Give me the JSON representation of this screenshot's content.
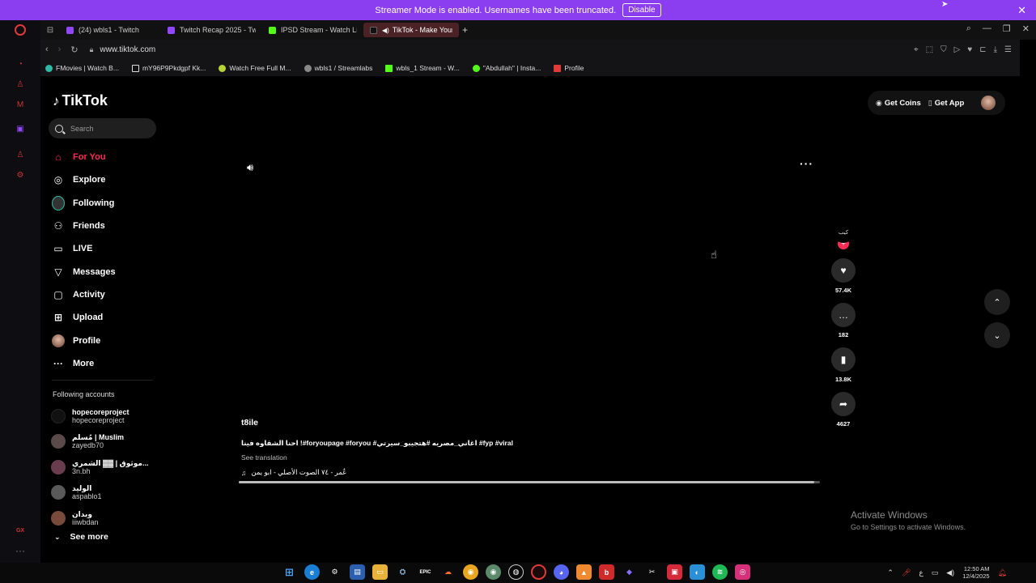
{
  "banner": {
    "message": "Streamer Mode is enabled. Usernames have been truncated.",
    "disable_label": "Disable"
  },
  "tabs": [
    {
      "label": "(24) wbls1 - Twitch",
      "color": "#9146ff"
    },
    {
      "label": "Twitch Recap 2025 - Twit",
      "color": "#9146ff"
    },
    {
      "label": "IPSD Stream - Watch Live",
      "color": "#53fc18"
    },
    {
      "label": "TikTok - Make Your D",
      "color": "#111111"
    }
  ],
  "address": {
    "url": "www.tiktok.com"
  },
  "bookmarks": [
    {
      "label": "FMovies | Watch B...",
      "color": "#2fb9a6"
    },
    {
      "label": "mY96P9Pkdgpf Kk...",
      "color": "#dddddd"
    },
    {
      "label": "Watch Free Full M...",
      "color": "#b5d334"
    },
    {
      "label": "wbls1 / Streamlabs",
      "color": "#888888"
    },
    {
      "label": "wbls_1 Stream - W...",
      "color": "#53fc18"
    },
    {
      "label": "\"Abdullah\" | Insta...",
      "color": "#53fc18"
    },
    {
      "label": "Profile",
      "color": "#e03a3a"
    }
  ],
  "tiktok": {
    "logo": "TikTok",
    "search_placeholder": "Search",
    "menu": [
      {
        "label": "For You",
        "icon": "home-icon"
      },
      {
        "label": "Explore",
        "icon": "compass-icon"
      },
      {
        "label": "Following",
        "icon": "following-icon"
      },
      {
        "label": "Friends",
        "icon": "friends-icon"
      },
      {
        "label": "LIVE",
        "icon": "live-icon"
      },
      {
        "label": "Messages",
        "icon": "messages-icon"
      },
      {
        "label": "Activity",
        "icon": "activity-icon"
      },
      {
        "label": "Upload",
        "icon": "upload-icon"
      },
      {
        "label": "Profile",
        "icon": "profile-icon"
      },
      {
        "label": "More",
        "icon": "more-icon"
      }
    ],
    "following_title": "Following accounts",
    "following": [
      {
        "name": "hopecoreproject",
        "handle": "hopecoreproject",
        "color": "#111111"
      },
      {
        "name": "مُسلم | Muslim",
        "handle": "zayedb70",
        "color": "#5a4a4a"
      },
      {
        "name": "موثوق | ▓▓ الشمري...",
        "handle": "3n.bh",
        "color": "#6a3d4e"
      },
      {
        "name": "الوليد",
        "handle": "aspablo1",
        "color": "#5a5a5a"
      },
      {
        "name": "وبدان",
        "handle": "iiiwbdan",
        "color": "#7a4a3a"
      }
    ],
    "see_more": "See more",
    "get_coins": "Get Coins",
    "get_app": "Get App",
    "video": {
      "author": "t8ile",
      "caption": "احنا الشقاوه فينا !#foryoupage #foryou #اغاني_مصريه #هتجيبو_سيرتي #fyp #viral",
      "see_translation": "See translation",
      "music": "عُمر - ٧٤ الصوت الأصلي - ابو يمن",
      "avatar_text": "كيب",
      "likes": "57.4K",
      "comments": "182",
      "saves": "13.8K",
      "shares": "4627",
      "progress": 0.99
    }
  },
  "windows": {
    "activate_title": "Activate Windows",
    "activate_sub": "Go to Settings to activate Windows."
  },
  "taskbar": {
    "time": "12:50 AM",
    "date": "12/4/2025"
  }
}
